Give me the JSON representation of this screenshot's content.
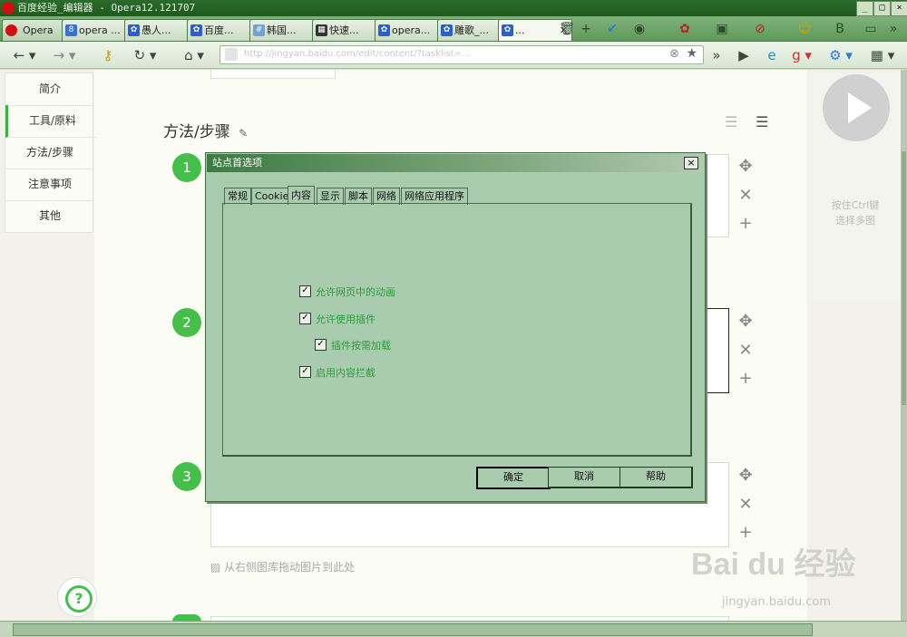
{
  "window": {
    "title": "百度经验_编辑器 - Opera12.121707",
    "minimize": "_",
    "restore": "□",
    "close": "×"
  },
  "tabs": [
    {
      "label": "Opera",
      "icon": "opera-menu-icon"
    },
    {
      "label": "opera ...",
      "icon": "google-icon"
    },
    {
      "label": "愚人...",
      "icon": "baidu-paw-icon"
    },
    {
      "label": "百度...",
      "icon": "baidu-paw-icon"
    },
    {
      "label": "韩国...",
      "icon": "hash-icon"
    },
    {
      "label": "快速...",
      "icon": "speed-dial-icon"
    },
    {
      "label": "opera...",
      "icon": "baidu-paw-icon"
    },
    {
      "label": "雕歌_...",
      "icon": "baidu-paw-icon"
    },
    {
      "label": "...",
      "icon": "baidu-paw-icon"
    }
  ],
  "navbar": {
    "url": "http://jingyan.baidu.com/edit/content/?tasklist=..."
  },
  "leftnav": {
    "items": [
      "简介",
      "工具/原料",
      "方法/步骤",
      "注意事项",
      "其他"
    ]
  },
  "section": {
    "title": "方法/步骤"
  },
  "steps": [
    "1",
    "2",
    "3"
  ],
  "image_hint": "从右侧图库拖动图片到此处",
  "right_panel": {
    "hint_line1": "按住Ctrl键",
    "hint_line2": "选择多图"
  },
  "dialog": {
    "title": "站点首选项",
    "close": "×",
    "tabs": [
      "常规",
      "Cookie",
      "内容",
      "显示",
      "脚本",
      "网络",
      "网络应用程序"
    ],
    "active_tab": "内容",
    "options": [
      {
        "label": "允许网页中的动画",
        "checked": true
      },
      {
        "label": "允许使用插件",
        "checked": true
      },
      {
        "label": "插件按需加载",
        "checked": true
      },
      {
        "label": "启用内容拦截",
        "checked": true
      }
    ],
    "buttons": {
      "ok": "确定",
      "cancel": "取消",
      "help": "帮助"
    }
  },
  "watermark": {
    "brand": "Bai du 经验",
    "url": "jingyan.baidu.com"
  },
  "colors": {
    "accent_green": "#44c04a",
    "dialog_bg": "#a9ccaf",
    "titlebar": "#2a6b2a"
  }
}
